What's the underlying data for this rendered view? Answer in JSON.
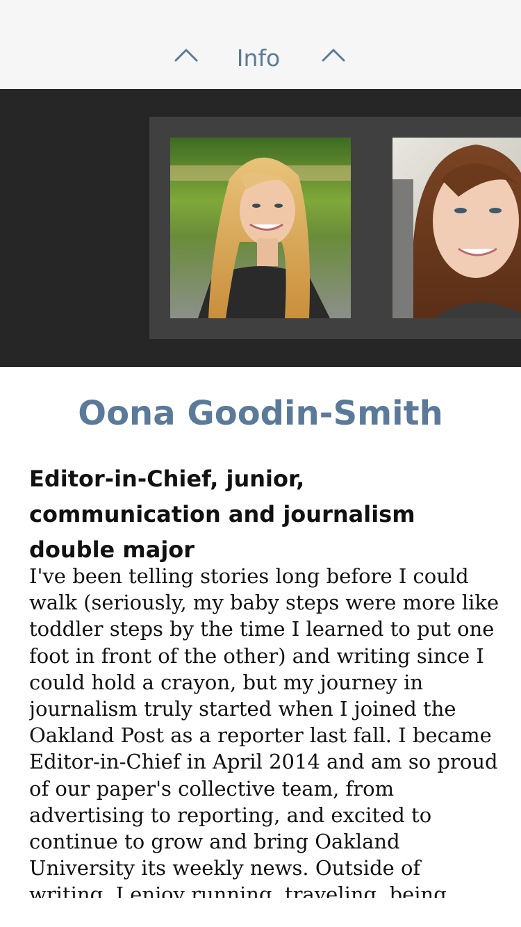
{
  "header": {
    "title": "Info",
    "prev_icon": "chevron-up-icon",
    "next_icon": "chevron-up-icon",
    "accent_color": "#5b7a99"
  },
  "gallery": {
    "photos": [
      {
        "label": "Portrait photo of a smiling woman with long blonde hair"
      },
      {
        "label": "Portrait photo of a smiling woman with auburn hair"
      }
    ]
  },
  "profile": {
    "name": "Oona Goodin-Smith",
    "role": "Editor-in-Chief, junior, communication and journalism double major",
    "bio": "I've been telling stories long before I could walk (seriously, my baby steps were more like toddler steps by the time I learned to put one foot in front of the other) and writing since I could hold a crayon, but my journey in journalism truly started when I joined the Oakland Post as a reporter last fall. I became Editor-in-Chief in April 2014 and am so proud of our paper's collective team, from advertising to reporting, and excited to continue to grow and bring Oakland University its weekly news. Outside of writing, I enjoy running, traveling, being"
  }
}
